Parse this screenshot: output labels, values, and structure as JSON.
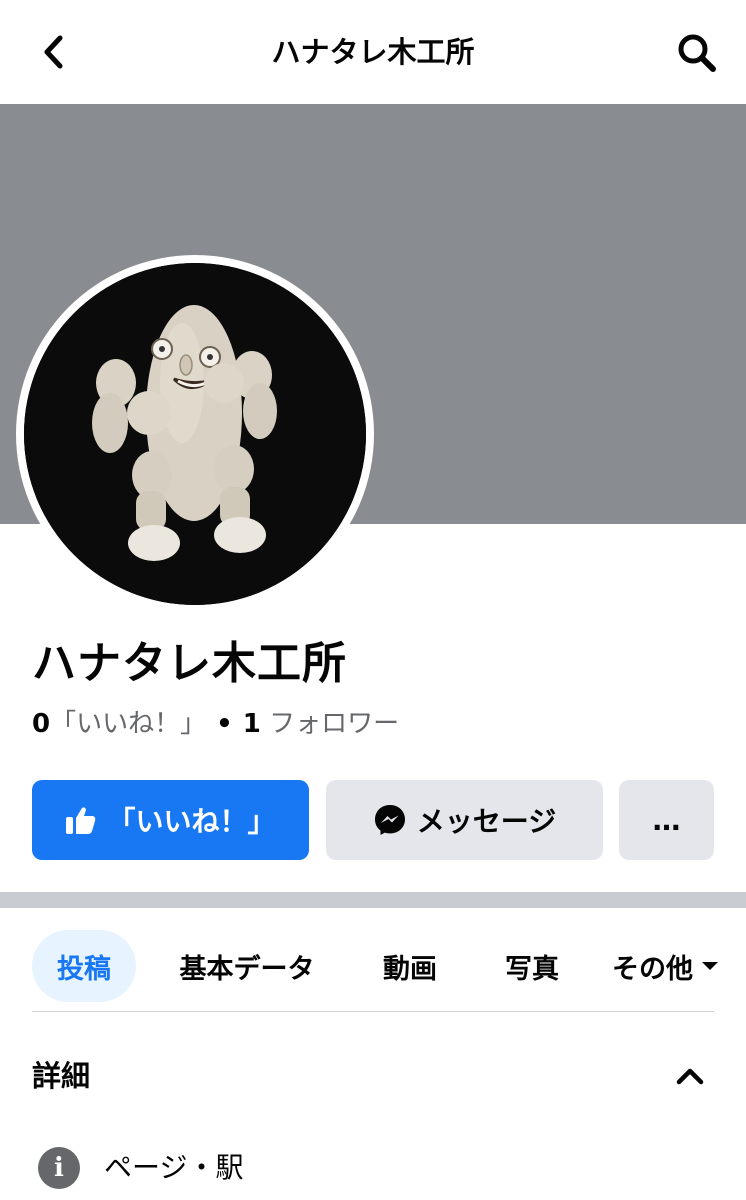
{
  "header": {
    "title": "ハナタレ木工所",
    "back_icon": "chevron-left-icon",
    "search_icon": "search-icon"
  },
  "profile": {
    "name": "ハナタレ木工所",
    "likes_count": "0",
    "likes_label": "「いいね！」",
    "followers_count": "1",
    "followers_label": "フォロワー",
    "separator": "•"
  },
  "actions": {
    "like_label": "「いいね！」",
    "message_label": "メッセージ",
    "more_label": "…"
  },
  "tabs": [
    {
      "label": "投稿",
      "active": true
    },
    {
      "label": "基本データ",
      "active": false
    },
    {
      "label": "動画",
      "active": false
    },
    {
      "label": "写真",
      "active": false
    },
    {
      "label": "その他",
      "active": false
    }
  ],
  "details": {
    "title": "詳細",
    "info_text": "ページ・駅"
  },
  "colors": {
    "primary": "#1877f2",
    "cover": "#898c90",
    "secondary_button": "#e4e6eb",
    "active_tab_bg": "#e7f3ff"
  }
}
